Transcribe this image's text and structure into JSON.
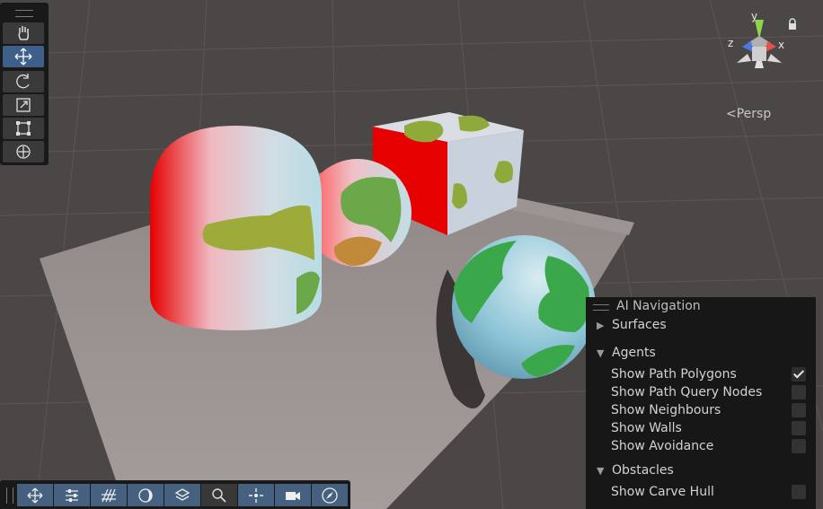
{
  "scene": {
    "background_color": "#4b4746",
    "view_mode": "Persp"
  },
  "tools": {
    "vertical": [
      {
        "name": "hand-tool",
        "active": false
      },
      {
        "name": "move-tool",
        "active": true
      },
      {
        "name": "rotate-tool",
        "active": false
      },
      {
        "name": "scale-tool",
        "active": false
      },
      {
        "name": "rect-tool",
        "active": false
      },
      {
        "name": "transform-tool",
        "active": false
      }
    ],
    "horizontal": [
      {
        "name": "move-overlay",
        "on": true
      },
      {
        "name": "toggles-overlay",
        "on": true
      },
      {
        "name": "grid-overlay",
        "on": true
      },
      {
        "name": "lighting-overlay",
        "on": true
      },
      {
        "name": "layers-overlay",
        "on": true
      },
      {
        "name": "search-overlay",
        "on": false
      },
      {
        "name": "pivot-overlay",
        "on": true
      },
      {
        "name": "camera-overlay",
        "on": true
      },
      {
        "name": "orientation-overlay",
        "on": true
      }
    ]
  },
  "gizmo": {
    "x_label": "x",
    "y_label": "y",
    "z_label": "z",
    "persp_label": "Persp",
    "x_color": "#e8504a",
    "y_color": "#8ed64a",
    "z_color": "#4a78e8"
  },
  "ai_nav": {
    "title": "AI Navigation",
    "surfaces": "Surfaces",
    "agents": "Agents",
    "options": [
      {
        "label": "Show Path Polygons",
        "checked": true
      },
      {
        "label": "Show Path Query Nodes",
        "checked": false
      },
      {
        "label": "Show Neighbours",
        "checked": false
      },
      {
        "label": "Show Walls",
        "checked": false
      },
      {
        "label": "Show Avoidance",
        "checked": false
      }
    ],
    "obstacles": "Obstacles",
    "obstacle_options": [
      {
        "label": "Show Carve Hull",
        "checked": false
      }
    ]
  }
}
